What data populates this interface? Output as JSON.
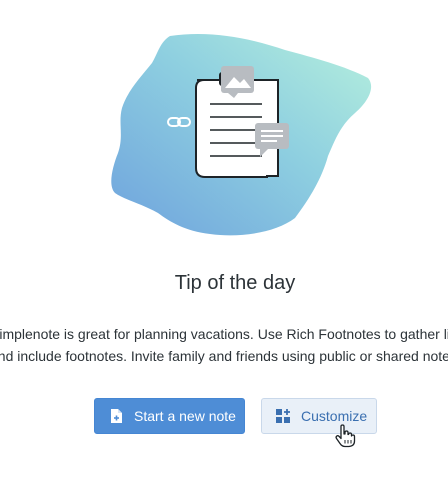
{
  "tip": {
    "title": "Tip of the day",
    "description_line1": "Simplenote is great for planning vacations. Use Rich Footnotes to gather links",
    "description_line2": "and include footnotes. Invite family and friends using public or shared notes."
  },
  "actions": {
    "new_note_label": "Start a new note",
    "customize_label": "Customize"
  },
  "colors": {
    "primary": "#4e8dd6",
    "secondary_bg": "#e9f0f8",
    "secondary_text": "#3a6fb0",
    "blob_left": "#6fa3dc",
    "blob_right": "#b1eede"
  },
  "icons": {
    "hero": [
      "link-icon",
      "note-document-icon",
      "image-icon",
      "comment-icon"
    ],
    "new_note": "new-note-icon",
    "customize": "customize-icon",
    "cursor": "hand-pointer-icon"
  }
}
